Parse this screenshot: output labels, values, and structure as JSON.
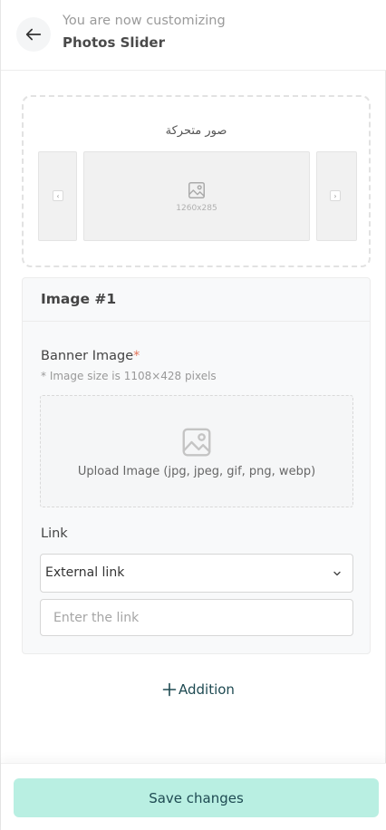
{
  "header": {
    "subtitle": "You are now customizing",
    "title": "Photos Slider",
    "back_icon": "arrow-left-icon"
  },
  "preview": {
    "title": "صور متحركة",
    "image_dimensions": "1260x285",
    "image_icon": "image-icon",
    "prev_arrow": "‹",
    "next_arrow": "›"
  },
  "card": {
    "title": "Image #1",
    "banner_label": "Banner Image",
    "required_mark": "*",
    "size_hint": "* Image size is 1108×428 pixels",
    "upload_text": "Upload Image (jpg, jpeg, gif, png, webp)",
    "upload_icon": "image-icon",
    "link_label": "Link",
    "link_type_selected": "External link",
    "link_placeholder": "Enter the link"
  },
  "add_button": {
    "label": "Addition",
    "icon": "plus-icon"
  },
  "footer": {
    "save_label": "Save changes"
  },
  "colors": {
    "accent": "#b9efe2",
    "accent_text": "#1e4a52",
    "required": "#e3745a"
  }
}
